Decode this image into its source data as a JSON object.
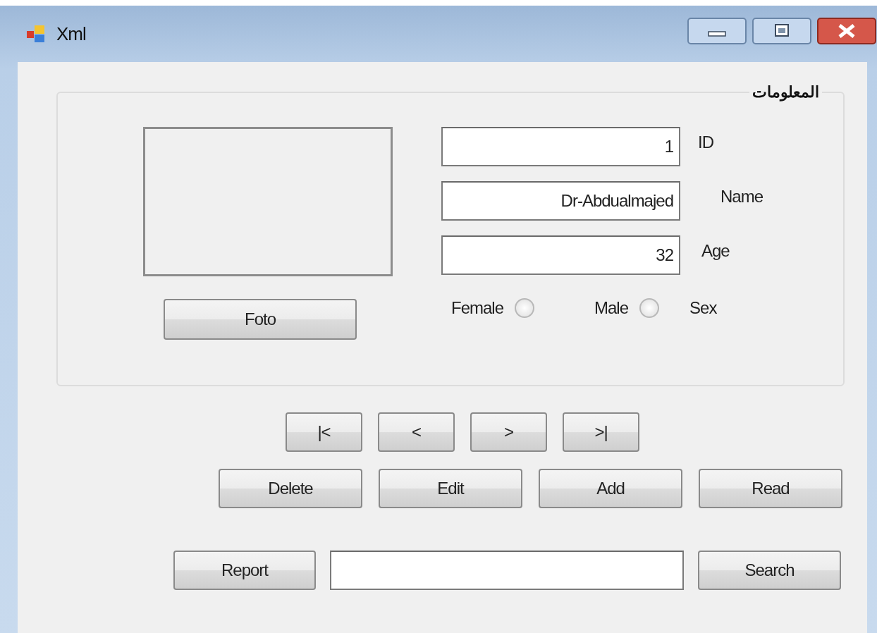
{
  "window": {
    "title": "Xml"
  },
  "group": {
    "title": "المعلومات"
  },
  "photo_button": "Foto",
  "fields": [
    {
      "label": "ID",
      "value": "1"
    },
    {
      "label": "Name",
      "value": "Dr-Abdualmajed"
    },
    {
      "label": "Age",
      "value": "32"
    }
  ],
  "sex": {
    "label": "Sex",
    "options": [
      {
        "label": "Female",
        "selected": false
      },
      {
        "label": "Male",
        "selected": false
      }
    ]
  },
  "nav_buttons": [
    "|<",
    "<",
    ">",
    ">|"
  ],
  "action_buttons": [
    "Delete",
    "Edit",
    "Add",
    "Read"
  ],
  "report_button": "Report",
  "search_button": "Search"
}
